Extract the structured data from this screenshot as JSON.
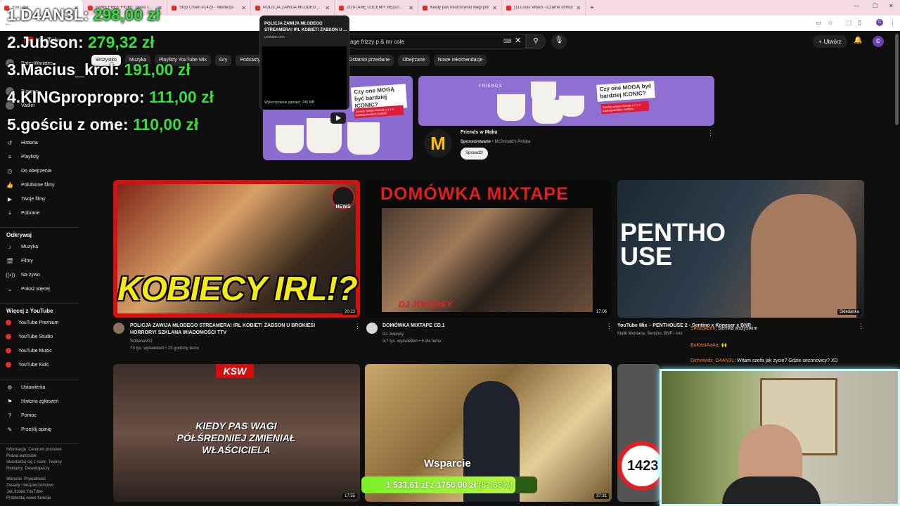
{
  "browser": {
    "tabs": [
      {
        "title": "YouTube",
        "fav_color": "#e52d27",
        "active": true
      },
      {
        "title": "FAME FREE FIGHT: Denis Labry",
        "fav_color": "#e52d27"
      },
      {
        "title": "Stop Cham #1423 - Niebezpi",
        "fav_color": "#e52d27"
      },
      {
        "title": "POLICJA ZAWIJA MŁODEGO ST",
        "fav_color": "#e52d27"
      },
      {
        "title": "ZOSTANĘ OJCEM!!! BĘDZIEMY",
        "fav_color": "#e52d27"
      },
      {
        "title": "Kiedy pas mistrzowski wagi pół",
        "fav_color": "#e52d27"
      },
      {
        "title": "(1) Louis Villain - Czarne chmur",
        "fav_color": "#e52d27"
      }
    ],
    "new_tab": "+",
    "tooltip": {
      "title": "POLICJA ZAWIJA MŁODEGO STREAMERA! IRL KOBIET! ŻABSON U ...",
      "url": "youtube.com",
      "memory": "Wykorzystanie pamięci: 246 MB"
    }
  },
  "youtube": {
    "logo": "YouTube",
    "search_value": "age frizzy p & mr cole",
    "create_label": "Utwórz",
    "avatar_letter": "C",
    "chips": [
      "Wszystko",
      "Muzyka",
      "Playlisty YouTube Mix",
      "Gry",
      "Podcasty"
    ],
    "chips_right": [
      "Ostatnio przesłane",
      "Obejrzane",
      "Nowe rekomendacje"
    ]
  },
  "sidebar": {
    "top_channels": [
      "PatecWariatec",
      "Bungee",
      "Vadler"
    ],
    "you_items": [
      "Historia",
      "Playlisty",
      "Do obejrzenia",
      "Polubione filmy",
      "Twoje filmy",
      "Pobrane"
    ],
    "explore_heading": "Odkrywaj",
    "explore_items": [
      "Muzyka",
      "Filmy",
      "Na żywo",
      "Pokaż więcej"
    ],
    "more_heading": "Więcej z YouTube",
    "more_items": [
      "YouTube Premium",
      "YouTube Studio",
      "YouTube Music",
      "YouTube Kids"
    ],
    "settings_items": [
      "Ustawienia",
      "Historia zgłoszeń",
      "Pomoc",
      "Prześlij opinię"
    ],
    "footer1": "Informacje  Centrum prasowe\nPrawa autorskie\nSkontaktuj się z nami  Twórcy\nReklamy  Deweloperzy",
    "footer2": "Warunki  Prywatność\nZasady i bezpieczeństwo\nJak działa YouTube\nPrzetestuj nowe funkcje"
  },
  "ranking": [
    {
      "label": "1.D4AN3L:",
      "amount": "298,00 zł"
    },
    {
      "label": "2.Jubson:",
      "amount": "279,32 zł"
    },
    {
      "label": "3.Macius_krol:",
      "amount": "191,00 zł"
    },
    {
      "label": "4.KINGpropropro:",
      "amount": "111,00 zł"
    },
    {
      "label": "5.gościu z ome:",
      "amount": "110,00 zł"
    }
  ],
  "ad": {
    "headline": "Czy one MOGĄ być bardziej ICONIC?",
    "sub": "Zamów zestaw Friends z 1 z 4 kolekcjonerskich kubków",
    "brand_text": "FRIENDS",
    "title": "Friends w Maku",
    "sponsored": "Sponsorowane",
    "advertiser": "McDonald's Polska",
    "button": "Sprawdź!"
  },
  "videos": [
    {
      "title": "POLICJA ZAWIJA MŁODEGO STREAMERA! IRL KOBIET! ŻABSON U BROKIES! HORRORY! SZKLANA WIADOMOŚCI TTV",
      "channel": "SzklanaV2J",
      "meta": "73 tys. wyświetleń • 23 godziny temu",
      "duration": "20:23",
      "thumb_text": "KOBIECY IRL!?",
      "badge": "NEWS"
    },
    {
      "title": "DOMÓWKA MIXTAPE CD.1",
      "channel": "DJ Jokerey",
      "meta": "9,7 tys. wyświetleń • 5 dni temu",
      "duration": "17:06",
      "thumb_text": "DOMÓWKA MIXTAPE",
      "thumb_sub": "DJ JOKEREY"
    },
    {
      "title": "YouTube Mix – PENTHOUSE 2 - Sentino x Koneser x BNP",
      "channel": "Malik Montana, Sentino, BNP i inni",
      "meta": "",
      "duration": "Składanka",
      "thumb_text": "PENTHOUSE"
    },
    {
      "title": "",
      "duration": "17:55",
      "thumb_text": "KIEDY PAS WAGI PÓŁŚREDNIEJ ZMIENIAŁ WŁAŚCICIELA",
      "brand": "KSW"
    },
    {
      "title": "",
      "duration": "37:31"
    },
    {
      "title": "",
      "thumb_text": "1423"
    }
  ],
  "chat": [
    {
      "name": "Strazakben",
      "text": "siemka wszystkim"
    },
    {
      "name": "BoKastAaAa",
      "text": "🙌"
    },
    {
      "name": "Dichowidz_D4AN3L",
      "text": "Witam szefa jak życie? Gdzie sezonowcy? XD"
    }
  ],
  "donation": {
    "label": "Wsparcie",
    "current": "1 533,61 zł",
    "separator": "z",
    "target": "1750,00 zł",
    "percent_text": "(87.63%)",
    "percent": 87.63
  },
  "colors": {
    "accent_green": "#35e03d",
    "yt_red": "#ff0000",
    "ad_purple": "#8c6cd0",
    "webcam_border": "#d3fbff"
  }
}
